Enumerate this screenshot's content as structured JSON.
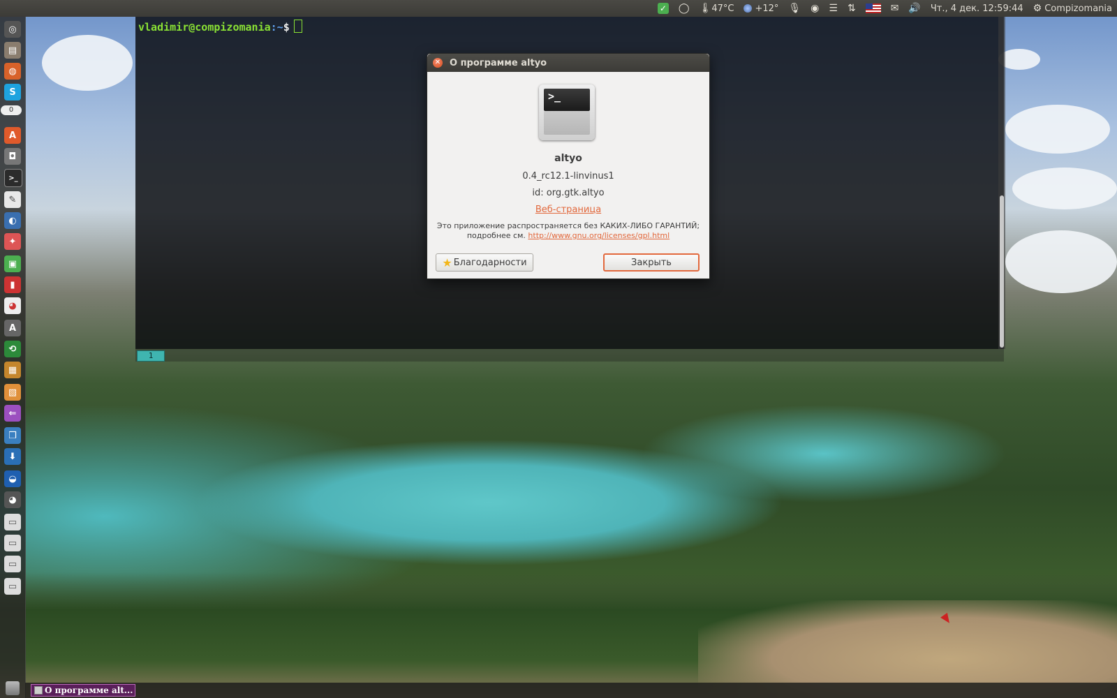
{
  "top_panel": {
    "temperature": "47°C",
    "weather": "+12°",
    "datetime": "Чт., 4 дек. 12:59:44",
    "user": "Compizomania"
  },
  "terminal": {
    "prompt_user": "vladimir@compizomania",
    "prompt_path": ":~",
    "prompt_symbol": "$",
    "tab_label": "1"
  },
  "dialog": {
    "title": "О программе altyo",
    "app_name": "altyo",
    "version": "0.4_rc12.1-linvinus1",
    "app_id": "id: org.gtk.altyo",
    "website_label": "Веб-страница",
    "license_text": "Это приложение распространяется без КАКИХ-ЛИБО ГАРАНТИЙ; подробнее см.",
    "license_link": "http://www.gnu.org/licenses/gpl.html",
    "credits_button": "Благодарности",
    "close_button": "Закрыть",
    "icon_glyph": ">_"
  },
  "launcher": {
    "badge": "0"
  },
  "taskbar": {
    "task_label": "О программе alt..."
  }
}
